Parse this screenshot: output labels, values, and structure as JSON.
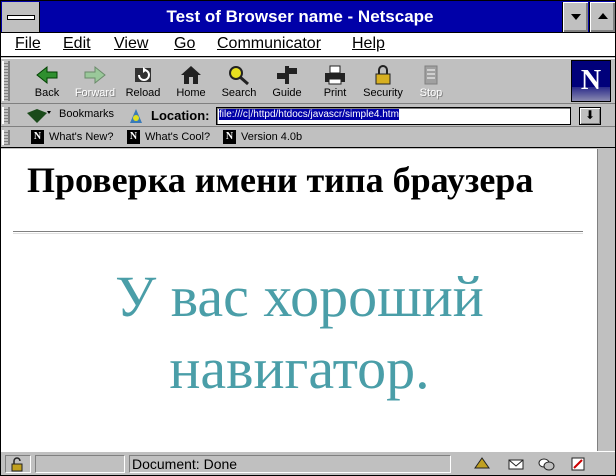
{
  "window": {
    "title": "Test of Browser name - Netscape"
  },
  "menu": {
    "file": "File",
    "edit": "Edit",
    "view": "View",
    "go": "Go",
    "communicator": "Communicator",
    "help": "Help"
  },
  "toolbar": {
    "back": "Back",
    "forward": "Forward",
    "reload": "Reload",
    "home": "Home",
    "search": "Search",
    "guide": "Guide",
    "print": "Print",
    "security": "Security",
    "stop": "Stop"
  },
  "location": {
    "bookmarks_label": "Bookmarks",
    "label": "Location:",
    "url": "file:///c|/httpd/htdocs/javascr/simple4.htm"
  },
  "personal": {
    "whats_new": "What's New?",
    "whats_cool": "What's Cool?",
    "version": "Version 4.0b"
  },
  "page": {
    "heading": "Проверка имени типа браузера",
    "message_line1": "У вас хороший",
    "message_line2": "навигатор.",
    "message_color": "#4a9ea8"
  },
  "status": {
    "text": "Document: Done"
  }
}
